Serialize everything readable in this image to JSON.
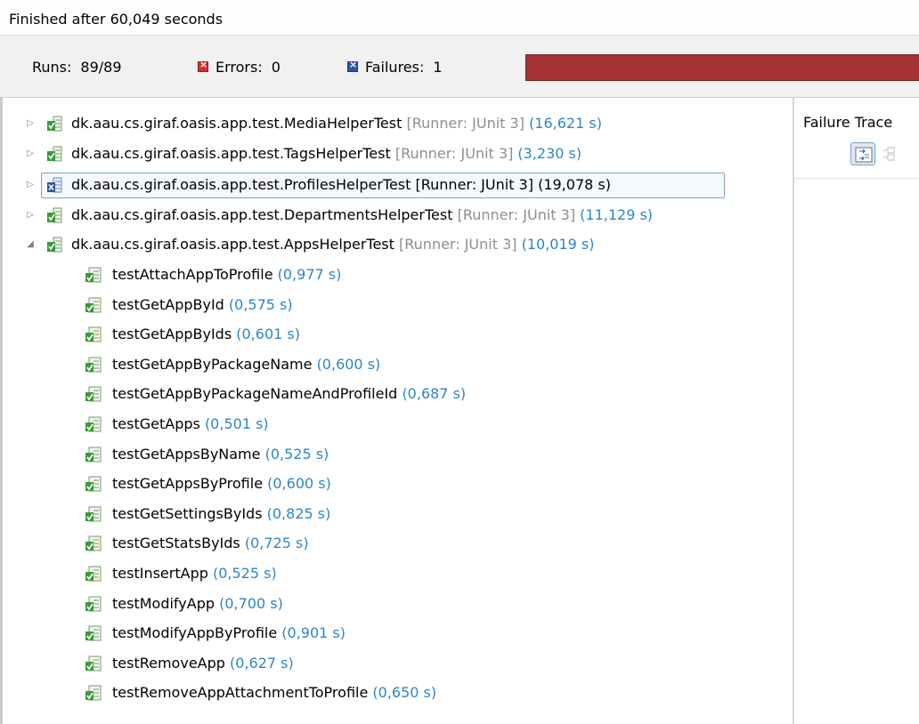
{
  "status": "Finished after 60,049 seconds",
  "counters": {
    "runs_label": "Runs:",
    "runs_value": "89/89",
    "errors_label": "Errors:",
    "errors_value": "0",
    "failures_label": "Failures:",
    "failures_value": "1"
  },
  "progress": {
    "value": 1.0,
    "color": "#a63434"
  },
  "trace": {
    "title": "Failure Trace"
  },
  "suites": [
    {
      "name": "dk.aau.cs.giraf.oasis.app.test.MediaHelperTest",
      "runner": "[Runner: JUnit 3]",
      "time": "(16,621 s)",
      "status": "pass",
      "expanded": false,
      "selected": false
    },
    {
      "name": "dk.aau.cs.giraf.oasis.app.test.TagsHelperTest",
      "runner": "[Runner: JUnit 3]",
      "time": "(3,230 s)",
      "status": "pass",
      "expanded": false,
      "selected": false
    },
    {
      "name": "dk.aau.cs.giraf.oasis.app.test.ProfilesHelperTest",
      "runner": "[Runner: JUnit 3]",
      "time": "(19,078 s)",
      "status": "fail",
      "expanded": false,
      "selected": true
    },
    {
      "name": "dk.aau.cs.giraf.oasis.app.test.DepartmentsHelperTest",
      "runner": "[Runner: JUnit 3]",
      "time": "(11,129 s)",
      "status": "pass",
      "expanded": false,
      "selected": false
    },
    {
      "name": "dk.aau.cs.giraf.oasis.app.test.AppsHelperTest",
      "runner": "[Runner: JUnit 3]",
      "time": "(10,019 s)",
      "status": "pass",
      "expanded": true,
      "selected": false
    }
  ],
  "tests": [
    {
      "name": "testAttachAppToProfile",
      "time": "(0,977 s)"
    },
    {
      "name": "testGetAppById",
      "time": "(0,575 s)"
    },
    {
      "name": "testGetAppByIds",
      "time": "(0,601 s)"
    },
    {
      "name": "testGetAppByPackageName",
      "time": "(0,600 s)"
    },
    {
      "name": "testGetAppByPackageNameAndProfileId",
      "time": "(0,687 s)"
    },
    {
      "name": "testGetApps",
      "time": "(0,501 s)"
    },
    {
      "name": "testGetAppsByName",
      "time": "(0,525 s)"
    },
    {
      "name": "testGetAppsByProfile",
      "time": "(0,600 s)"
    },
    {
      "name": "testGetSettingsByIds",
      "time": "(0,825 s)"
    },
    {
      "name": "testGetStatsByIds",
      "time": "(0,725 s)"
    },
    {
      "name": "testInsertApp",
      "time": "(0,525 s)"
    },
    {
      "name": "testModifyApp",
      "time": "(0,700 s)"
    },
    {
      "name": "testModifyAppByProfile",
      "time": "(0,901 s)"
    },
    {
      "name": "testRemoveApp",
      "time": "(0,627 s)"
    },
    {
      "name": "testRemoveAppAttachmentToProfile",
      "time": "(0,650 s)"
    }
  ],
  "icons": {
    "suite_pass": "suite-pass-icon",
    "suite_fail": "suite-fail-icon",
    "test_pass": "test-pass-icon",
    "collapsed": "chevron-right-icon",
    "expanded": "chevron-down-icon"
  }
}
